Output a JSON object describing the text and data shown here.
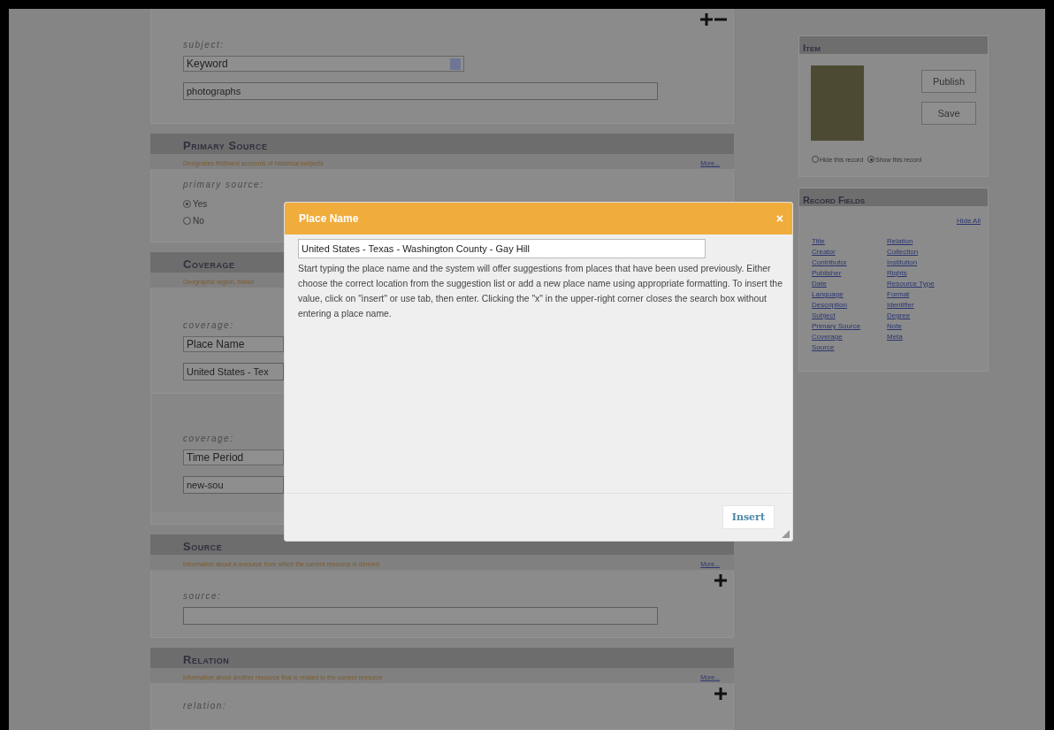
{
  "subject_block": {
    "label": "subject:",
    "select": "Keyword",
    "value": "photographs"
  },
  "sections": [
    {
      "title": "Primary Source",
      "description": "Designates firsthand accounts of historical subjects",
      "more": "More...",
      "addable": false,
      "fields": [
        {
          "kind": "radio",
          "label": "primary source:",
          "options": [
            {
              "label": "Yes",
              "selected": true
            },
            {
              "label": "No",
              "selected": false
            }
          ]
        }
      ]
    },
    {
      "title": "Coverage",
      "description": "Geographic region, histori",
      "addable": false,
      "fields": [
        {
          "kind": "select_input",
          "label": "coverage:",
          "select": "Place Name",
          "value": "United States - Tex"
        },
        {
          "kind": "select_input",
          "label": "coverage:",
          "select": "Time Period",
          "value": "new-sou"
        }
      ]
    },
    {
      "title": "Source",
      "description": "Information about a resource from which the current resource is derived",
      "more": "More...",
      "addable": true,
      "fields": [
        {
          "kind": "input",
          "label": "source:"
        }
      ]
    },
    {
      "title": "Relation",
      "description": "Information about another resource that is related to the current resource",
      "more": "More...",
      "addable": true,
      "fields": [
        {
          "kind": "label",
          "label": "relation:"
        }
      ]
    }
  ],
  "item_panel": {
    "title": "Item",
    "buttons": [
      "Publish",
      "Save"
    ],
    "visibility": [
      {
        "label": "Hide this record",
        "selected": false
      },
      {
        "label": "Show this record",
        "selected": true
      }
    ]
  },
  "record_fields": {
    "title": "Record Fields",
    "hide_all": "Hide All",
    "columns": [
      [
        "Title",
        "Creator",
        "Contributor",
        "Publisher",
        "Date",
        "Language",
        "Description",
        "Subject",
        "Primary Source",
        "Coverage",
        "Source"
      ],
      [
        "Relation",
        "Collection",
        "Institution",
        "Rights",
        "Resource Type",
        "Format",
        "Identifier",
        "Degree",
        "Note",
        "Meta"
      ]
    ]
  },
  "modal": {
    "title": "Place Name",
    "close": "×",
    "value": "United States - Texas - Washington County - Gay Hill",
    "help": "Start typing the place name and the system will offer suggestions from places that have been used previously. Either choose the correct location from the suggestion list or add a new place name using appropriate formatting. To insert the value, click on \"insert\" or use tab, then enter. Clicking the \"x\" in the upper-right corner closes the search box without entering a place name.",
    "insert": "Insert"
  }
}
